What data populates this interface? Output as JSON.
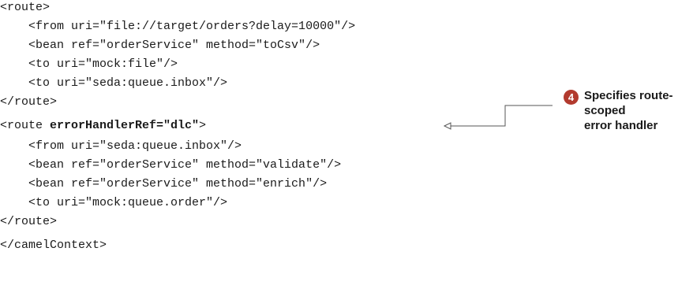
{
  "code": {
    "lines": [
      "<route>",
      "    <from uri=\"file://target/orders?delay=10000\"/>",
      "    <bean ref=\"orderService\" method=\"toCsv\"/>",
      "    <to uri=\"mock:file\"/>",
      "    <to uri=\"seda:queue.inbox\"/>",
      "</route>",
      "",
      "<route ",
      "errorHandlerRef=\"dlc\"",
      ">",
      "    <from uri=\"seda:queue.inbox\"/>",
      "    <bean ref=\"orderService\" method=\"validate\"/>",
      "    <bean ref=\"orderService\" method=\"enrich\"/>",
      "    <to uri=\"mock:queue.order\"/>",
      "</route>",
      "",
      "</camelContext>"
    ]
  },
  "callout": {
    "number": "4",
    "text_line1": "Specifies route-scoped",
    "text_line2": "error handler"
  }
}
